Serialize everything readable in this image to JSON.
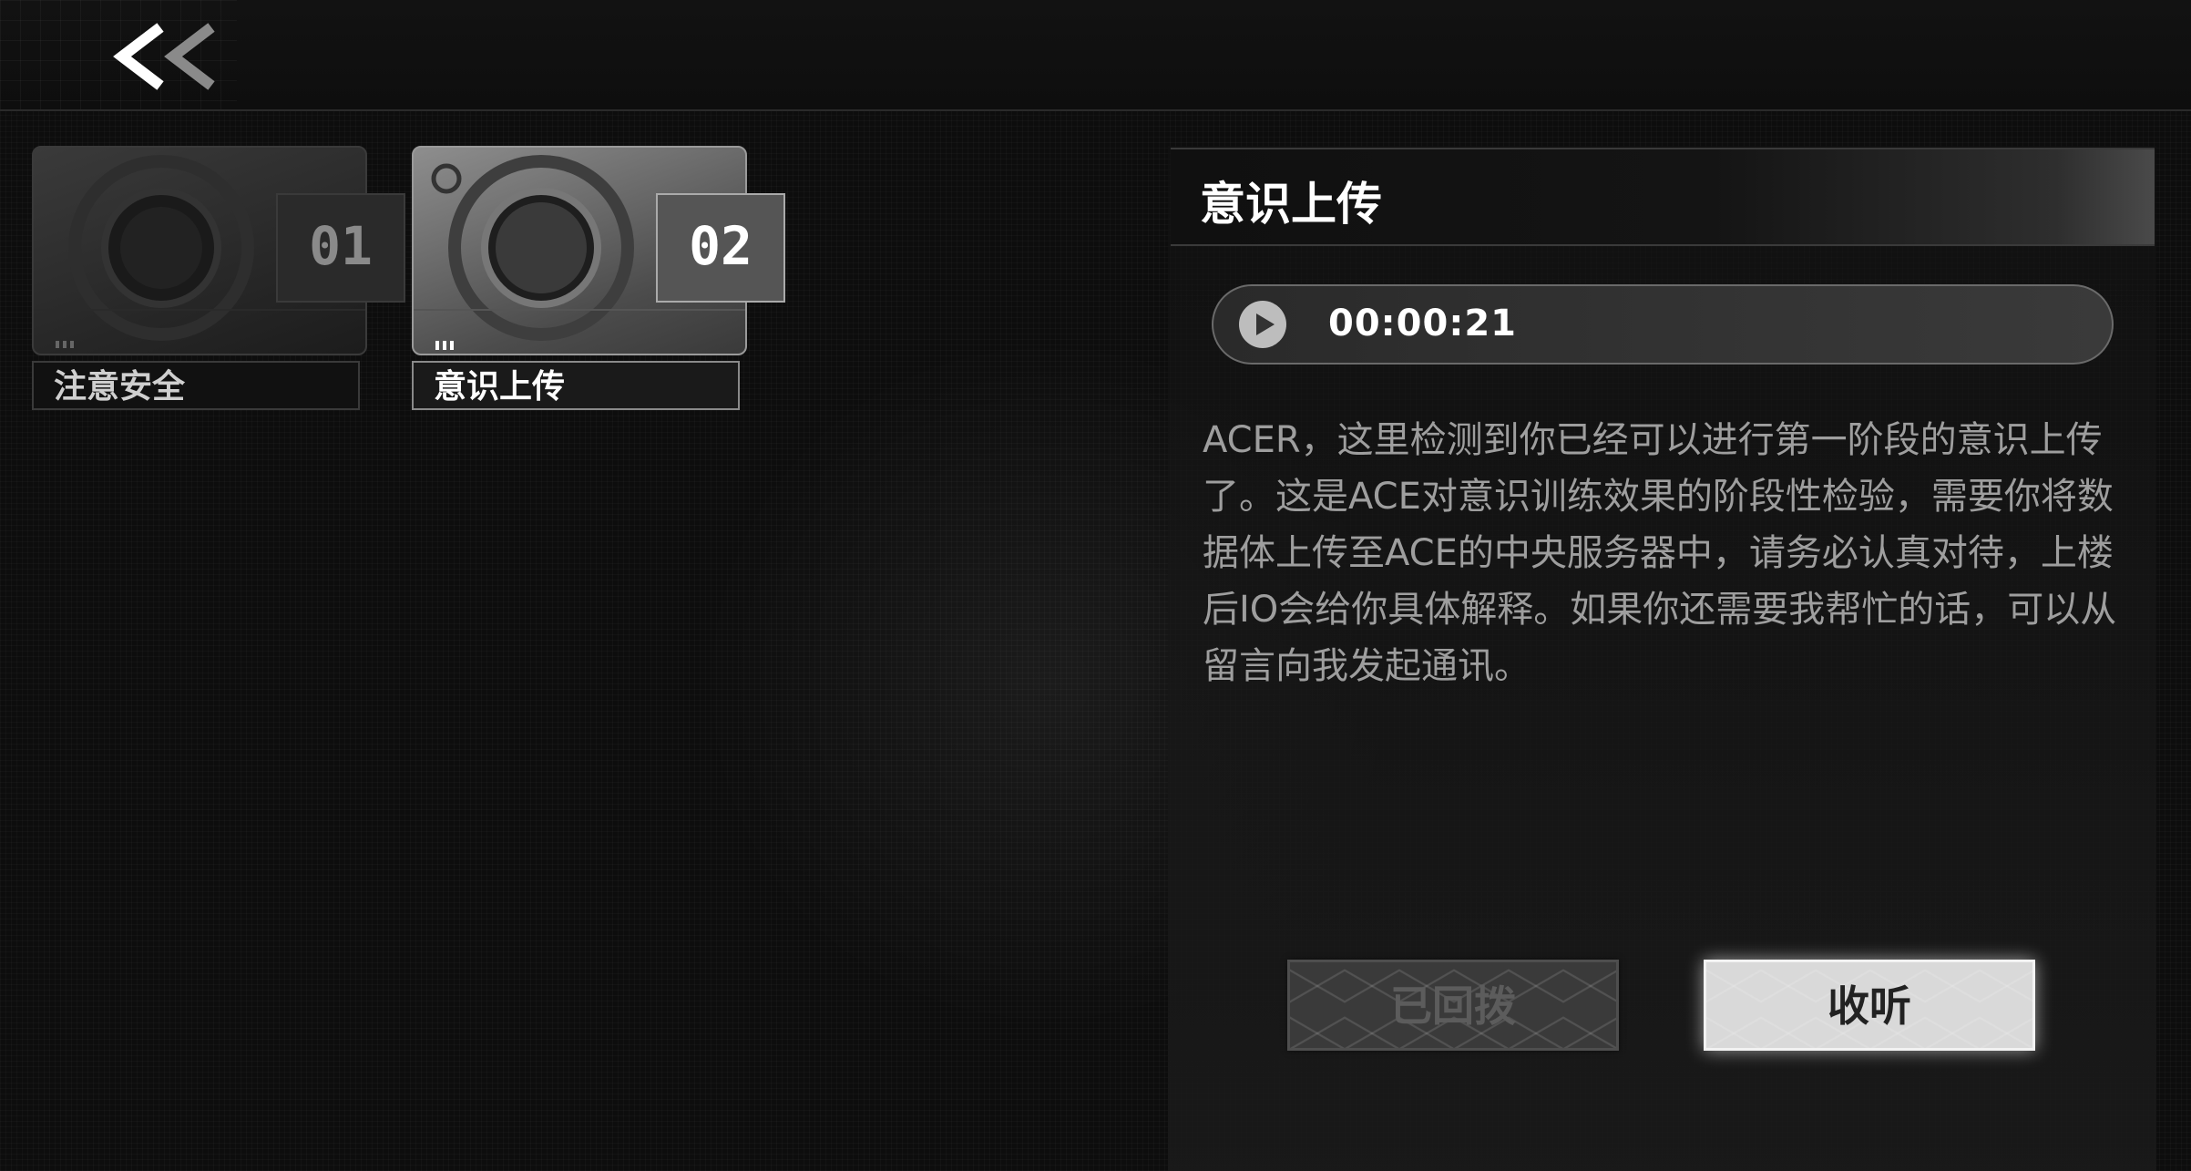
{
  "nav": {
    "back_icon": "double-chevron-left-icon"
  },
  "messages": [
    {
      "number": "01",
      "title": "注意安全",
      "active": false
    },
    {
      "number": "02",
      "title": "意识上传",
      "active": true
    }
  ],
  "detail": {
    "title": "意识上传",
    "audio": {
      "duration": "00:00:21",
      "play_icon": "play-icon"
    },
    "body": "ACER，这里检测到你已经可以进行第一阶段的意识上传了。这是ACE对意识训练效果的阶段性检验，需要你将数据体上传至ACE的中央服务器中，请务必认真对待，上楼后IO会给你具体解释。如果你还需要我帮忙的话，可以从留言向我发起通讯。"
  },
  "actions": {
    "redial_label": "已回拨",
    "listen_label": "收听"
  },
  "colors": {
    "background": "#0d0d0d",
    "accent": "#d9d9d9",
    "text_muted": "#9e9e9e"
  }
}
